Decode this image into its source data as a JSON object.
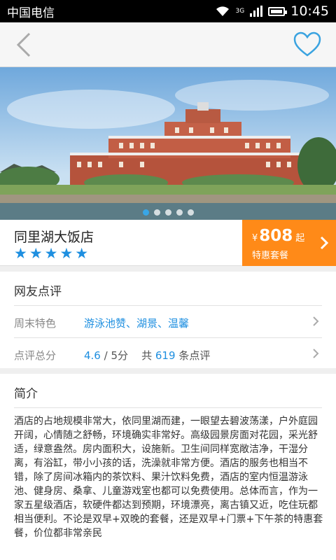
{
  "status_bar": {
    "carrier": "中国电信",
    "time": "10:45",
    "network": "3G"
  },
  "nav": {
    "back_icon": "chevron-left-icon",
    "favorite_icon": "heart-outline-icon"
  },
  "gallery": {
    "total": 5,
    "active_index": 0
  },
  "hotel": {
    "name": "同里湖大饭店",
    "stars": "★★★★★",
    "star_count": 5
  },
  "price": {
    "currency": "¥",
    "value": "808",
    "unit": "起",
    "label": "特惠套餐"
  },
  "reviews": {
    "title": "网友点评",
    "weekend_label": "周末特色",
    "weekend_value": "游泳池赞、湖景、温馨",
    "score_label": "点评总分",
    "score": "4.6",
    "score_max": "/ 5分",
    "count_prefix": "共",
    "count": "619",
    "count_suffix": "条点评"
  },
  "intro": {
    "title": "简介",
    "text": "酒店的占地规模非常大，依同里湖而建，一眼望去碧波荡漾，户外庭园开阔，心情随之舒畅，环境确实非常好。高级园景房面对花园，采光舒适，绿意盎然。房内面积大，设施新。卫生间同样宽敞洁净，干湿分离，有浴缸，带小小孩的话，洗澡就非常方便。酒店的服务也相当不错，除了房间冰箱内的茶饮料、果汁饮料免费，酒店的室内恒温游泳池、健身房、桑拿、儿童游戏室也都可以免费使用。总体而言，作为一家五星级酒店，软硬件都达到预期，环境漂亮，离古镇又近，吃住玩都相当便利。不论是双早+双晚的套餐，还是双早+门票+下午茶的特惠套餐，价位都非常亲民"
  },
  "colors": {
    "accent": "#1e8fe0",
    "price_bg": "#ff8a18",
    "star": "#1e8fe0"
  }
}
